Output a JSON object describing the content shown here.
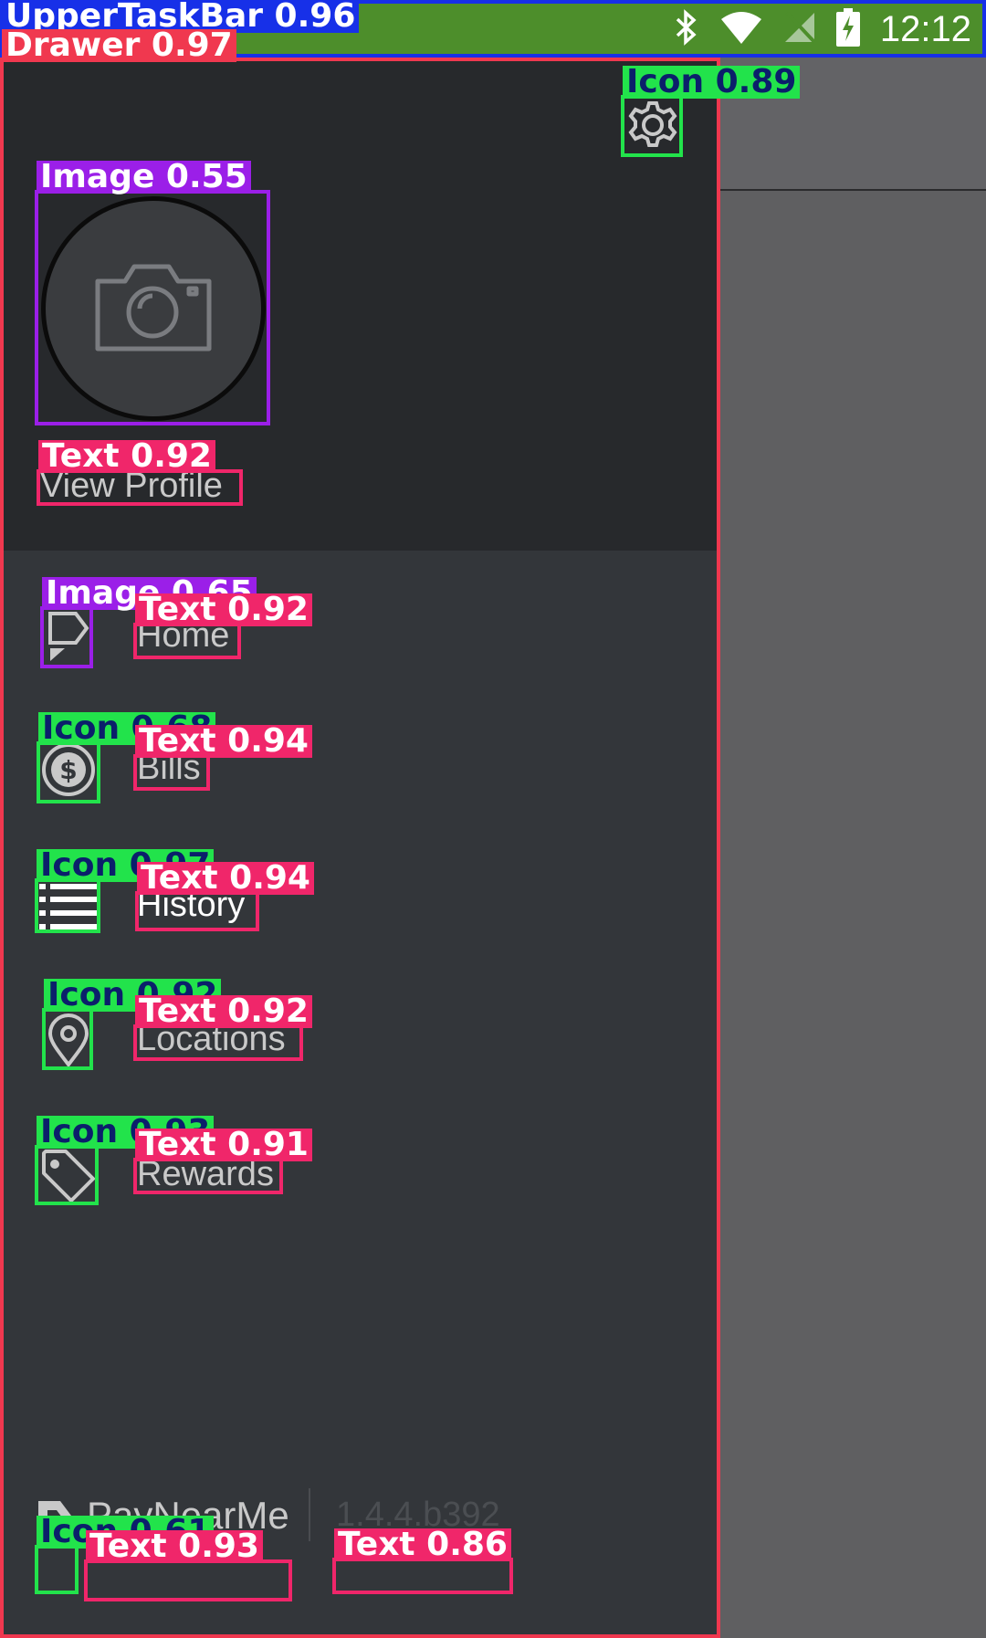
{
  "status_bar": {
    "time": "12:12",
    "icons": [
      "bluetooth-icon",
      "wifi-icon",
      "no-signal-icon",
      "battery-charging-icon"
    ]
  },
  "drawer": {
    "profile": {
      "avatar_icon": "camera-icon",
      "label": "View Profile"
    },
    "settings_icon": "gear-icon",
    "menu": [
      {
        "label": "Home",
        "icon": "home-tag-icon"
      },
      {
        "label": "Bills",
        "icon": "dollar-coin-icon"
      },
      {
        "label": "History",
        "icon": "list-icon"
      },
      {
        "label": "Locations",
        "icon": "map-pin-icon"
      },
      {
        "label": "Rewards",
        "icon": "price-tag-icon"
      }
    ],
    "footer": {
      "brand": "PayNearMe",
      "version": "1.4.4.b392"
    }
  },
  "annotations": [
    {
      "label": "UpperTaskBar 0.96",
      "color": "#1730e8",
      "text_color": "#ffffff"
    },
    {
      "label": "Drawer 0.97",
      "color": "#f0384f",
      "text_color": "#ffffff"
    },
    {
      "label": "Icon 0.89",
      "color": "#22e34b",
      "text_color": "#0b1f6b"
    },
    {
      "label": "Image 0.55",
      "color": "#9b1fe8",
      "text_color": "#ffffff"
    },
    {
      "label": "Text 0.92",
      "color": "#f0266a",
      "text_color": "#ffffff"
    },
    {
      "label": "Image 0.65",
      "color": "#9b1fe8",
      "text_color": "#ffffff"
    },
    {
      "label": "Text 0.92",
      "color": "#f0266a",
      "text_color": "#ffffff"
    },
    {
      "label": "Icon 0.68",
      "color": "#22e34b",
      "text_color": "#0b1f6b"
    },
    {
      "label": "Text 0.94",
      "color": "#f0266a",
      "text_color": "#ffffff"
    },
    {
      "label": "Icon 0.97",
      "color": "#22e34b",
      "text_color": "#0b1f6b"
    },
    {
      "label": "Text 0.94",
      "color": "#f0266a",
      "text_color": "#ffffff"
    },
    {
      "label": "Icon 0.92",
      "color": "#22e34b",
      "text_color": "#0b1f6b"
    },
    {
      "label": "Text 0.92",
      "color": "#f0266a",
      "text_color": "#ffffff"
    },
    {
      "label": "Icon 0.93",
      "color": "#22e34b",
      "text_color": "#0b1f6b"
    },
    {
      "label": "Text 0.91",
      "color": "#f0266a",
      "text_color": "#ffffff"
    },
    {
      "label": "Icon 0.61",
      "color": "#22e34b",
      "text_color": "#0b1f6b"
    },
    {
      "label": "Text 0.93",
      "color": "#f0266a",
      "text_color": "#ffffff"
    },
    {
      "label": "Text 0.86",
      "color": "#f0266a",
      "text_color": "#ffffff"
    }
  ]
}
